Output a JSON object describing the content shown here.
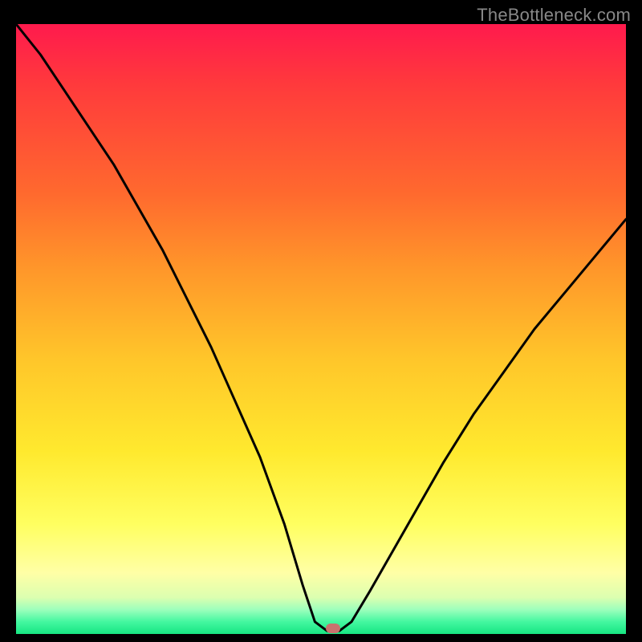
{
  "watermark": "TheBottleneck.com",
  "marker": {
    "x_pct": 52,
    "y_pct": 99.1,
    "color": "#c9726e"
  },
  "chart_data": {
    "type": "line",
    "title": "",
    "xlabel": "",
    "ylabel": "",
    "xlim": [
      0,
      100
    ],
    "ylim": [
      0,
      100
    ],
    "grid": false,
    "legend": false,
    "series": [
      {
        "name": "curve",
        "x": [
          0,
          4,
          8,
          12,
          16,
          20,
          24,
          28,
          32,
          36,
          40,
          44,
          47,
          49,
          51,
          53,
          55,
          58,
          62,
          66,
          70,
          75,
          80,
          85,
          90,
          95,
          100
        ],
        "y": [
          100,
          95,
          89,
          83,
          77,
          70,
          63,
          55,
          47,
          38,
          29,
          18,
          8,
          2,
          0.5,
          0.5,
          2,
          7,
          14,
          21,
          28,
          36,
          43,
          50,
          56,
          62,
          68
        ]
      }
    ],
    "gradient_stops": [
      {
        "pct": 0,
        "color": "#ff1a4d"
      },
      {
        "pct": 28,
        "color": "#ff6a2e"
      },
      {
        "pct": 55,
        "color": "#ffc62a"
      },
      {
        "pct": 82,
        "color": "#ffff60"
      },
      {
        "pct": 96,
        "color": "#9dffbc"
      },
      {
        "pct": 100,
        "color": "#16e682"
      }
    ]
  }
}
